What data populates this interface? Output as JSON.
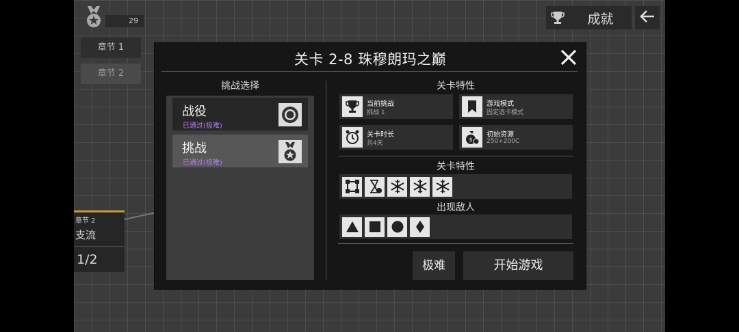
{
  "hud": {
    "medal_count": "29",
    "chapters": [
      "章节 1",
      "章节 2"
    ],
    "achievements_label": "成就"
  },
  "background": {
    "chapter_node": {
      "title": "章节 2",
      "name": "支流",
      "progress": "1/2"
    }
  },
  "modal": {
    "title": "关卡 2-8 珠穆朗玛之巅",
    "left_header": "挑战选择",
    "modes": [
      {
        "name": "战役",
        "status": "已通过(极难)",
        "icon": "target-icon"
      },
      {
        "name": "挑战",
        "status": "已通过(极难)",
        "icon": "medal-icon"
      }
    ],
    "info_header": "关卡特性",
    "info": [
      {
        "title": "当前挑战",
        "value": "挑战 1",
        "icon": "trophy-icon"
      },
      {
        "title": "游戏模式",
        "value": "固定选卡模式",
        "icon": "bookmark-icon"
      },
      {
        "title": "关卡时长",
        "value": "共4天",
        "icon": "alarm-clock-icon"
      },
      {
        "title": "初始资源",
        "value": "250+200C",
        "icon": "money-bag-icon"
      }
    ],
    "traits_header": "关卡特性",
    "traits": [
      "frame-icon",
      "hourglass-icon",
      "snowflake-icon",
      "snowflake-icon",
      "snowflake-icon"
    ],
    "enemies_header": "出现敌人",
    "enemies": [
      "triangle-icon",
      "square-icon",
      "circle-icon",
      "diamond-icon"
    ],
    "difficulty_button": "极难",
    "start_button": "开始游戏"
  },
  "colors": {
    "status_purple": "#b47cf2",
    "chapter_accent": "#c79a3a"
  }
}
